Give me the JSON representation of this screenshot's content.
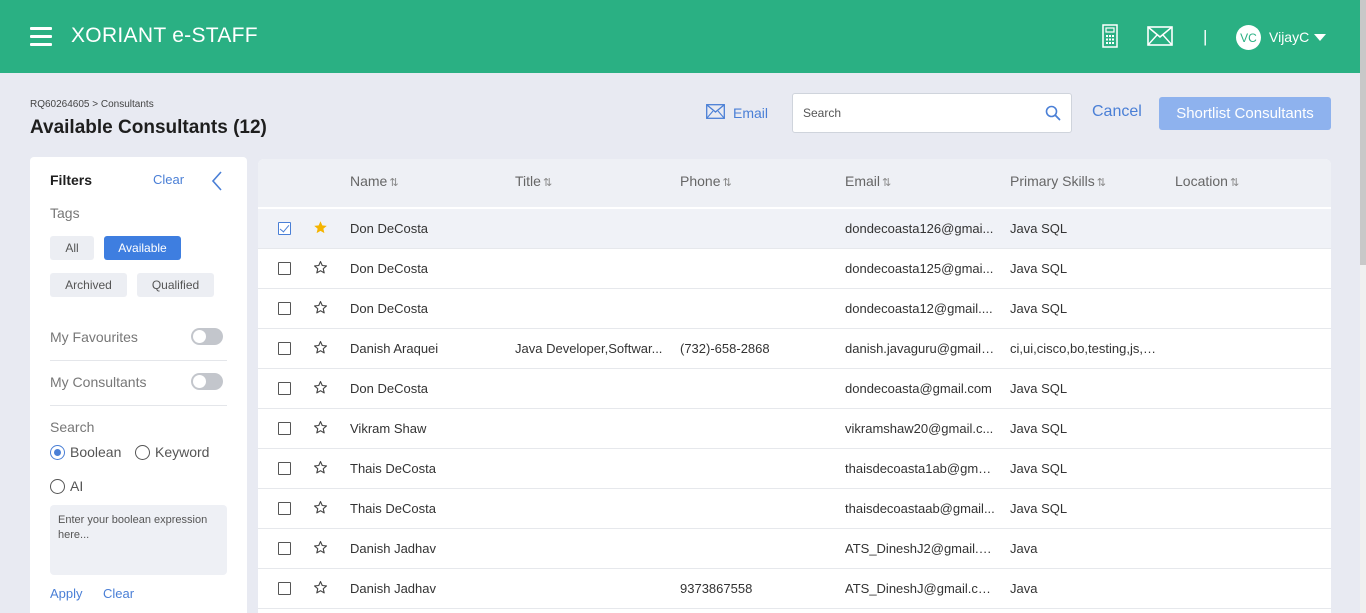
{
  "header": {
    "brand": "XORIANT e-STAFF",
    "separator": "|",
    "avatar_initials": "VC",
    "username": "VijayC",
    "color": "#2ab083"
  },
  "page": {
    "breadcrumb": "RQ60264605 > Consultants",
    "title": "Available Consultants (12)",
    "email_label": "Email",
    "search_placeholder": "Search",
    "cancel_label": "Cancel",
    "shortlist_label": "Shortlist Consultants"
  },
  "filters": {
    "title": "Filters",
    "clear_label": "Clear",
    "tags_label": "Tags",
    "tags": [
      "All",
      "Available",
      "Archived",
      "Qualified"
    ],
    "active_tag": "Available",
    "my_favourites_label": "My Favourites",
    "my_consultants_label": "My Consultants",
    "search_label": "Search",
    "search_modes": [
      "Boolean",
      "Keyword",
      "AI"
    ],
    "selected_mode": "Boolean",
    "expression_placeholder": "Enter your boolean expression here...",
    "apply_label": "Apply",
    "clear2_label": "Clear"
  },
  "table": {
    "sort_glyph": "⇅",
    "columns": [
      "Name",
      "Title",
      "Phone",
      "Email",
      "Primary Skills",
      "Location"
    ],
    "rows": [
      {
        "name": "Don DeCosta",
        "title": "",
        "phone": "",
        "email": "dondecoasta126@gmai...",
        "skills": "Java SQL",
        "location": "",
        "checked": true,
        "favourite": true
      },
      {
        "name": "Don DeCosta",
        "title": "",
        "phone": "",
        "email": "dondecoasta125@gmai...",
        "skills": "Java SQL",
        "location": "",
        "checked": false,
        "favourite": false
      },
      {
        "name": "Don DeCosta",
        "title": "",
        "phone": "",
        "email": "dondecoasta12@gmail....",
        "skills": "Java SQL",
        "location": "",
        "checked": false,
        "favourite": false
      },
      {
        "name": "Danish Araquei",
        "title": "Java Developer,Softwar...",
        "phone": "(732)-658-2868",
        "email": "danish.javaguru@gmail....",
        "skills": "ci,ui,cisco,bo,testing,js,s...",
        "location": "",
        "checked": false,
        "favourite": false
      },
      {
        "name": "Don DeCosta",
        "title": "",
        "phone": "",
        "email": "dondecoasta@gmail.com",
        "skills": "Java SQL",
        "location": "",
        "checked": false,
        "favourite": false
      },
      {
        "name": "Vikram Shaw",
        "title": "",
        "phone": "",
        "email": "vikramshaw20@gmail.c...",
        "skills": "Java SQL",
        "location": "",
        "checked": false,
        "favourite": false
      },
      {
        "name": "Thais DeCosta",
        "title": "",
        "phone": "",
        "email": "thaisdecoasta1ab@gma...",
        "skills": "Java SQL",
        "location": "",
        "checked": false,
        "favourite": false
      },
      {
        "name": "Thais DeCosta",
        "title": "",
        "phone": "",
        "email": "thaisdecoastaab@gmail...",
        "skills": "Java SQL",
        "location": "",
        "checked": false,
        "favourite": false
      },
      {
        "name": "Danish Jadhav",
        "title": "",
        "phone": "",
        "email": "ATS_DineshJ2@gmail.c...",
        "skills": "Java",
        "location": "",
        "checked": false,
        "favourite": false
      },
      {
        "name": "Danish Jadhav",
        "title": "",
        "phone": "9373867558",
        "email": "ATS_DineshJ@gmail.com",
        "skills": "Java",
        "location": "",
        "checked": false,
        "favourite": false
      }
    ]
  }
}
